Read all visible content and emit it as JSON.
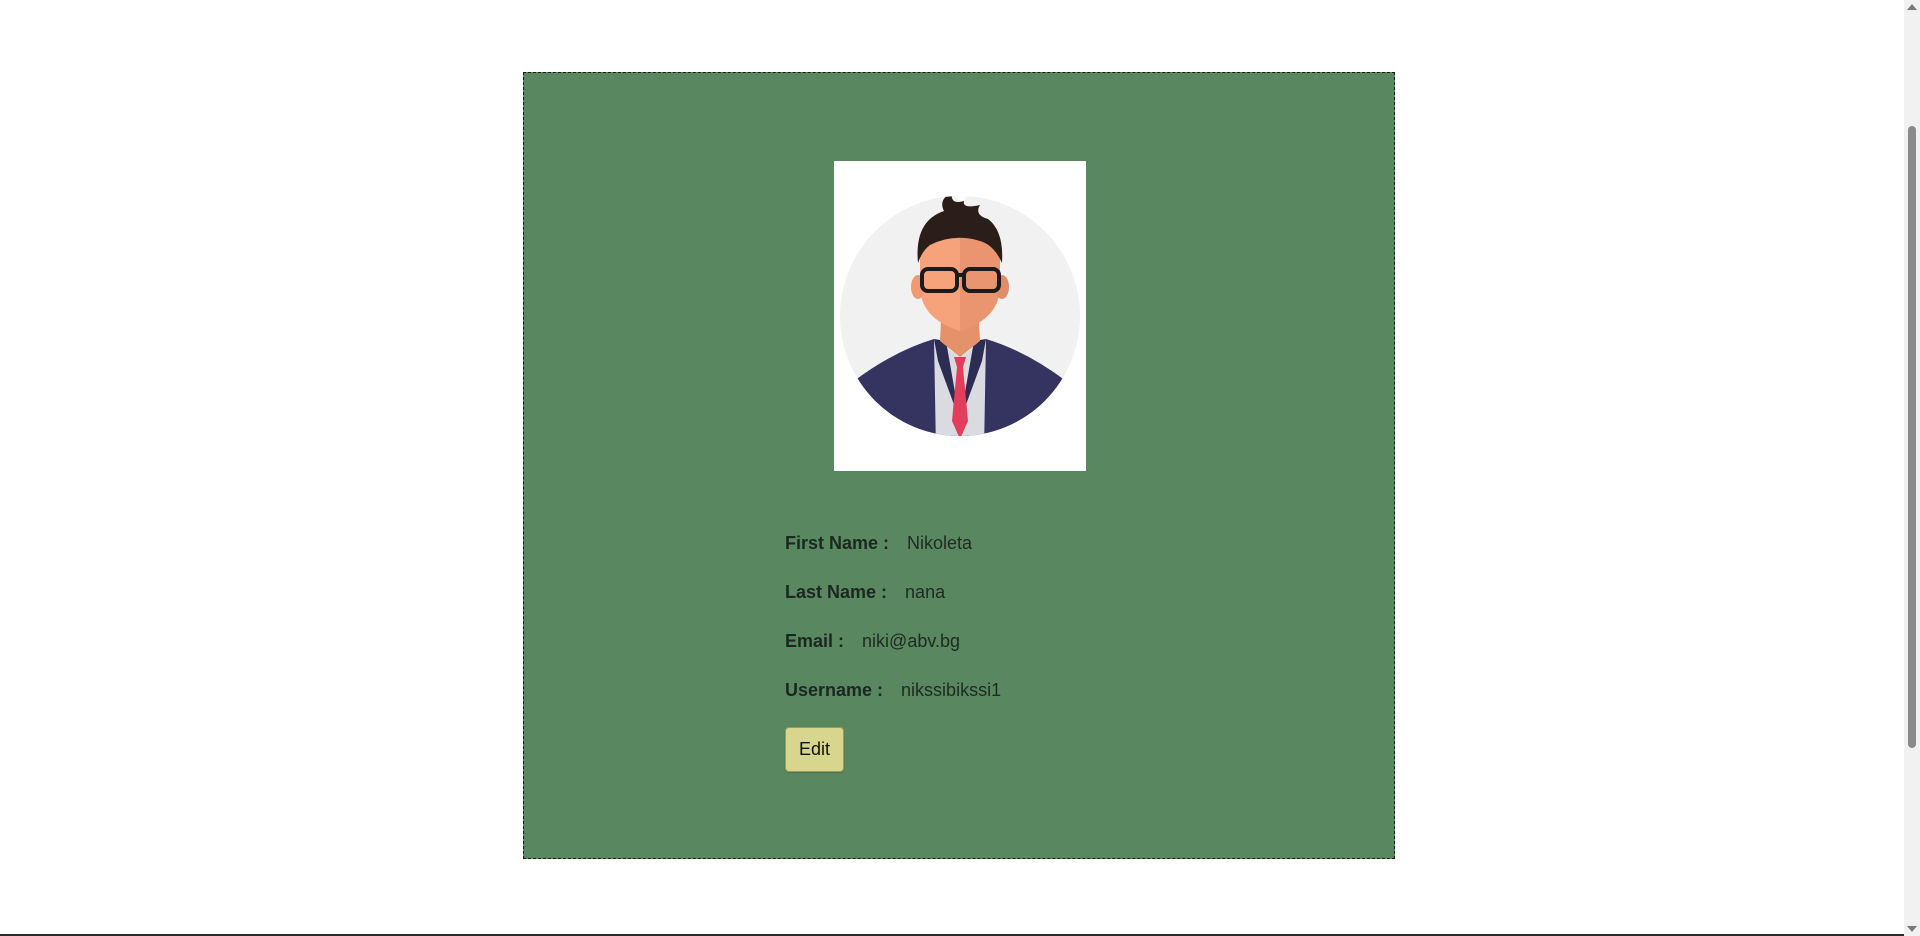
{
  "profile": {
    "avatar_icon": "businessman-avatar-icon",
    "fields": [
      {
        "label": "First Name :",
        "value": "Nikoleta"
      },
      {
        "label": "Last Name :",
        "value": "nana"
      },
      {
        "label": "Email :",
        "value": "niki@abv.bg"
      },
      {
        "label": "Username :",
        "value": "nikssibikssi1"
      }
    ],
    "edit_label": "Edit"
  },
  "colors": {
    "card_background": "#588760",
    "button_background": "#d7d68c",
    "page_background": "#ffffff"
  }
}
